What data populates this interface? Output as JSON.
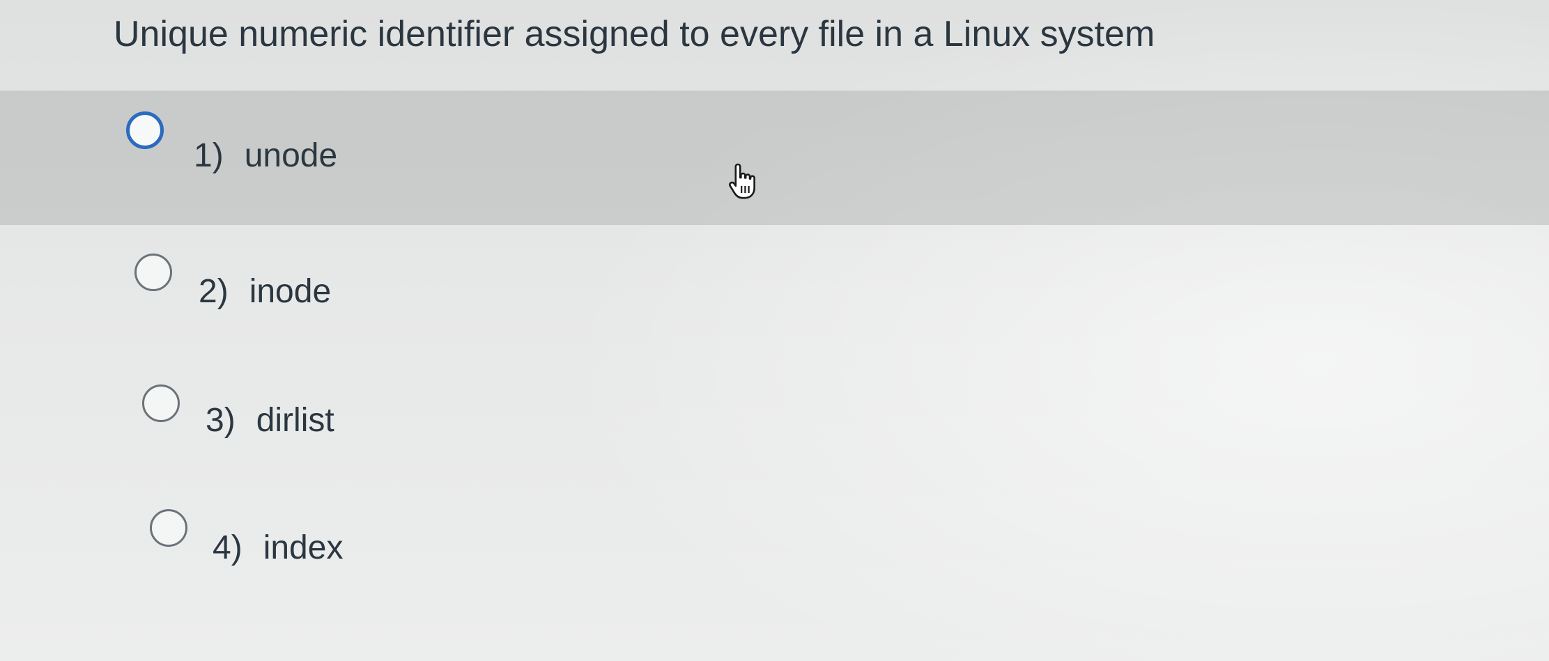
{
  "question": {
    "text": "Unique numeric identifier assigned to every file in a Linux system"
  },
  "options": [
    {
      "number": "1)",
      "label": "unode",
      "hovered": true
    },
    {
      "number": "2)",
      "label": "inode",
      "hovered": false
    },
    {
      "number": "3)",
      "label": "dirlist",
      "hovered": false
    },
    {
      "number": "4)",
      "label": "index",
      "hovered": false
    }
  ],
  "colors": {
    "text": "#2b3740",
    "hover_row": "#b6b7b8",
    "radio_focus": "#2b6bbf",
    "radio_border": "#6b7278"
  },
  "cursor": {
    "icon": "hand-pointer-icon"
  }
}
